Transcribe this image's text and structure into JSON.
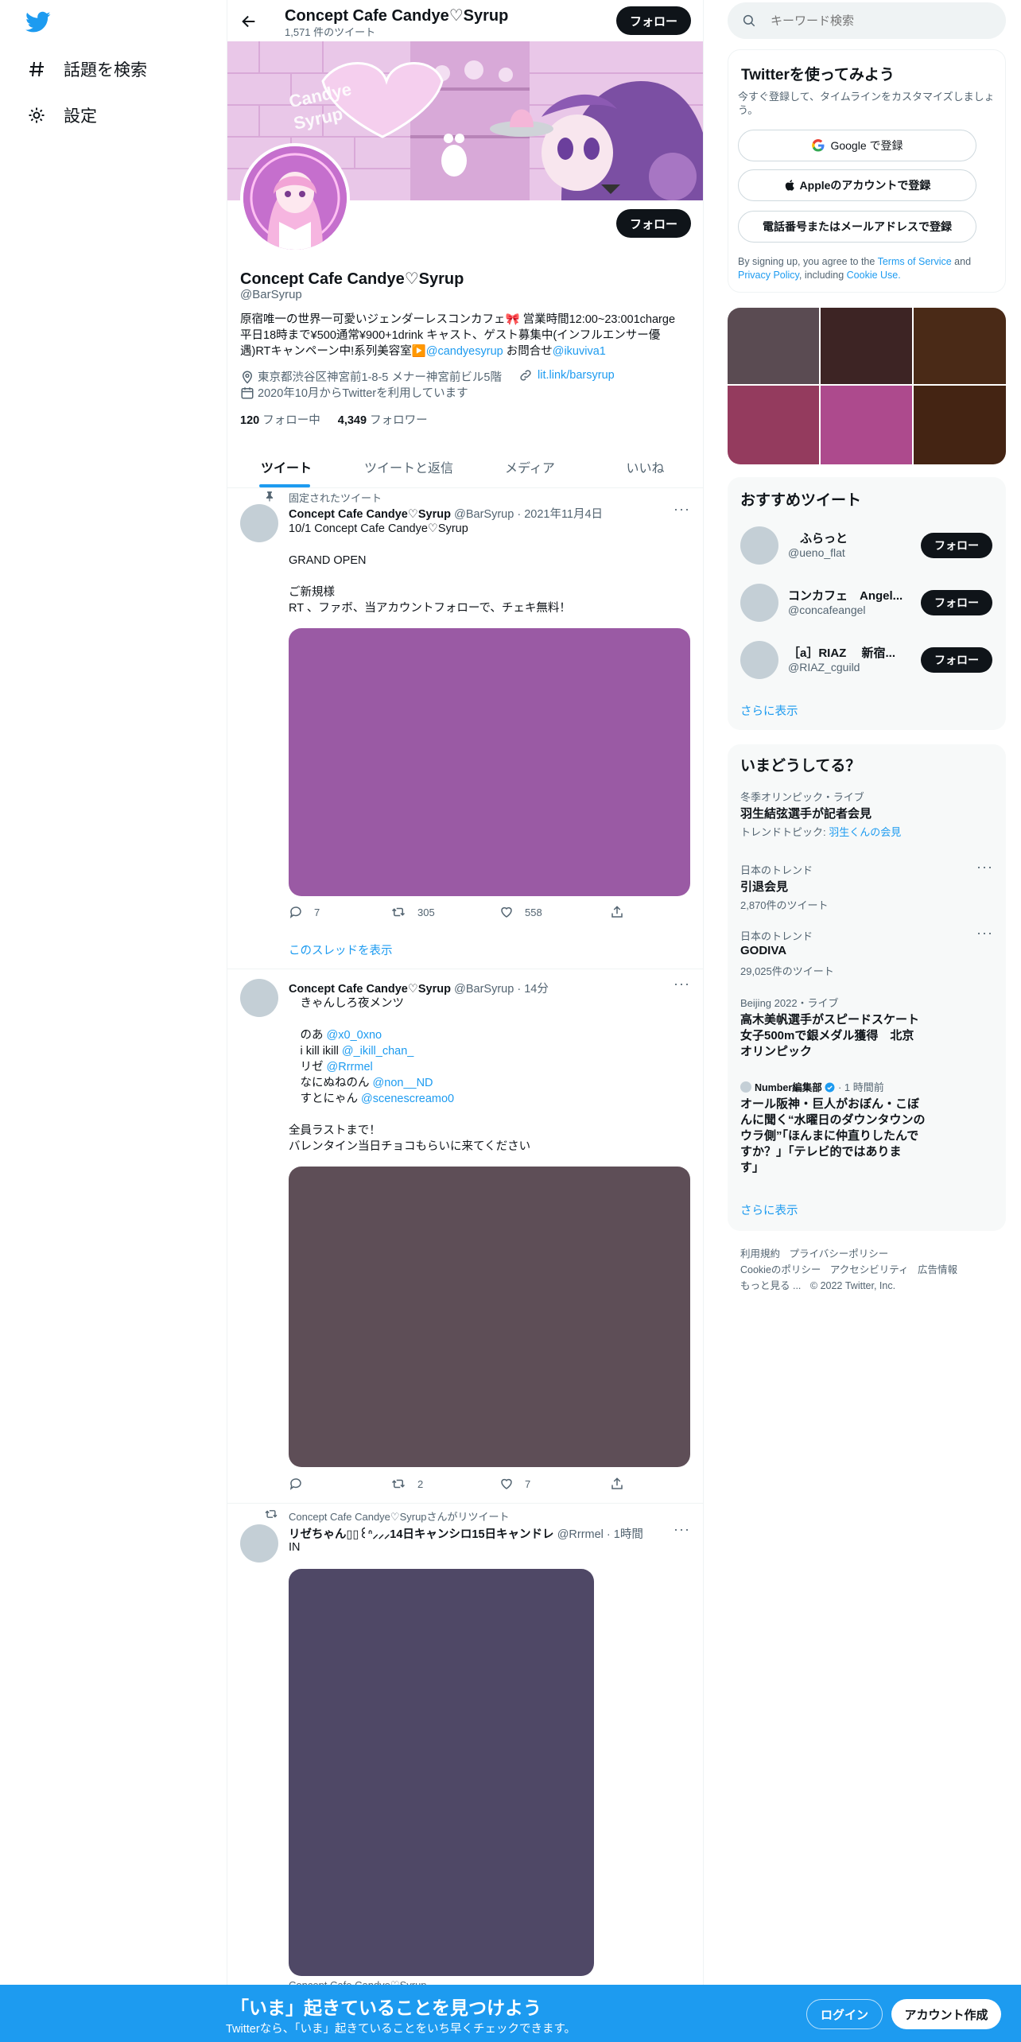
{
  "nav": {
    "explore_label": "話題を検索",
    "settings_label": "設定"
  },
  "header": {
    "name": "Concept Cafe Candye♡Syrup",
    "tweet_count": "1,571 件のツイート",
    "follow_label": "フォロー"
  },
  "profile": {
    "follow_label": "フォロー",
    "name": "Concept Cafe Candye♡Syrup",
    "handle": "@BarSyrup",
    "bio_line1": "原宿唯一の世界一可愛いジェンダーレスコンカフェ🎀 営業時間12:00~23:001charge",
    "bio_line2": "平日18時まで¥500通常¥900+1drink キャスト、ゲスト募集中(インフルエンサー優",
    "bio_line3_text": "遇)RTキャンペーン中!系列美容室▶️",
    "bio_line3_link1": "@candyesyrup",
    "bio_line3_mid": " お問合せ",
    "bio_line3_link2": "@ikuviva1",
    "location": "東京都渋谷区神宮前1-8-5 メナー神宮前ビル5階",
    "website": "lit.link/barsyrup",
    "joined": "2020年10月からTwitterを利用しています",
    "following_count": "120",
    "following_label": "フォロー中",
    "followers_count": "4,349",
    "followers_label": "フォロワー",
    "banner_text": "Candye Syrup"
  },
  "tabs": [
    "ツイート",
    "ツイートと返信",
    "メディア",
    "いいね"
  ],
  "tweets": [
    {
      "context": "固定されたツイート",
      "name": "Concept Cafe Candye♡Syrup",
      "meta": "@BarSyrup · 2021年11月4日",
      "lines": [
        "10/1 Concept Cafe Candye♡Syrup",
        "",
        "GRAND OPEN",
        "",
        "ご新規様",
        "RT 、ファボ、当アカウントフォローで、チェキ無料！"
      ],
      "media_color": "#9a5aa4",
      "replies": "7",
      "retweets": "305",
      "likes": "558",
      "thread_label": "このスレッドを表示"
    },
    {
      "name": "Concept Cafe Candye♡Syrup",
      "meta": "@BarSyrup · 14分",
      "line1": "　きゃんしろ夜メンツ",
      "mentions": [
        {
          "prefix": "　のあ ",
          "handle": "@x0_0xno"
        },
        {
          "prefix": "　i kill ikill ",
          "handle": "@_ikill_chan_"
        },
        {
          "prefix": "　リゼ ",
          "handle": "@Rrrmel"
        },
        {
          "prefix": "　なにぬねのん ",
          "handle": "@non__ND"
        },
        {
          "prefix": "　すとにゃん ",
          "handle": "@scenescreamo0"
        }
      ],
      "line_last1": "全員ラストまで！",
      "line_last2": "バレンタイン当日チョコもらいに来てください",
      "media_color": "#5e4e57",
      "replies": "",
      "retweets": "2",
      "likes": "7"
    },
    {
      "context": "Concept Cafe Candye♡Syrupさんがリツイート",
      "name": "リゼちゃん▯▯꒰ᐢ⸝⸝⸝14日キャンシロ15日キャンドレ",
      "meta": "@Rrrmel · 1時間",
      "line1": "IN",
      "media_color": "#4f4866",
      "next_context": "Concept Cafe Candye♡Syrup"
    }
  ],
  "search": {
    "placeholder": "キーワード検索"
  },
  "signup": {
    "title": "Twitterを使ってみよう",
    "subtitle": "今すぐ登録して、タイムラインをカスタマイズしましょう。",
    "google": "Google で登録",
    "apple": "Appleのアカウントで登録",
    "phone": "電話番号またはメールアドレスで登録",
    "legal_1": "By signing up, you agree to the ",
    "legal_tos": "Terms of Service",
    "legal_2": " and",
    "legal_privacy": "Privacy Policy",
    "legal_3": ", including ",
    "legal_cookie": "Cookie Use."
  },
  "media_grid_colors": [
    "#5a4b52",
    "#3d2424",
    "#4a2a17",
    "#943b5e",
    "#ad4a8d",
    "#442413"
  ],
  "recommended": {
    "title": "おすすめツイート",
    "users": [
      {
        "name": "　ふらっと",
        "handle": "@ueno_flat"
      },
      {
        "name": "コンカフェ　Angel...",
        "handle": "@concafeangel"
      },
      {
        "name": "［a］RIAZ　 新宿...",
        "handle": "@RIAZ_cguild"
      }
    ],
    "follow_label": "フォロー",
    "more": "さらに表示"
  },
  "trends": {
    "title": "いまどうしてる？",
    "items": [
      {
        "meta": "冬季オリンピック・ライブ",
        "name": "羽生結弦選手が記者会見",
        "sub_prefix": "トレンドトピック: ",
        "sub_link": "羽生くんの会見"
      },
      {
        "meta": "日本のトレンド",
        "name": "引退会見",
        "sub": "2,870件のツイート"
      },
      {
        "meta": "日本のトレンド",
        "name": "GODIVA",
        "sub": "29,025件のツイート"
      },
      {
        "meta": "Beijing 2022・ライブ",
        "name_lines": [
          "高木美帆選手がスピードスケート",
          "女子500mで銀メダル獲得　北京",
          "オリンピック"
        ]
      },
      {
        "source": "Number編集部",
        "time": "· 1 時間前",
        "name_lines": [
          "オール阪神・巨人がおぼん・こぼ",
          "んに聞く“水曜日のダウンタウンの",
          "ウラ側”「ほんまに仲直りしたんで",
          "すか？」「テレビ的ではありま",
          "す」"
        ]
      }
    ],
    "more": "さらに表示"
  },
  "footer": {
    "line1": [
      "利用規約",
      "プライバシーポリシー"
    ],
    "line2": [
      "Cookieのポリシー",
      "アクセシビリティ",
      "広告情報"
    ],
    "line3": [
      "もっと見る ...",
      "© 2022 Twitter, Inc."
    ]
  },
  "bottom_bar": {
    "title": "「いま」起きていることを見つけよう",
    "subtitle": "Twitterなら、「いま」起きていることをいち早くチェックできます。",
    "login": "ログイン",
    "signup": "アカウント作成"
  }
}
